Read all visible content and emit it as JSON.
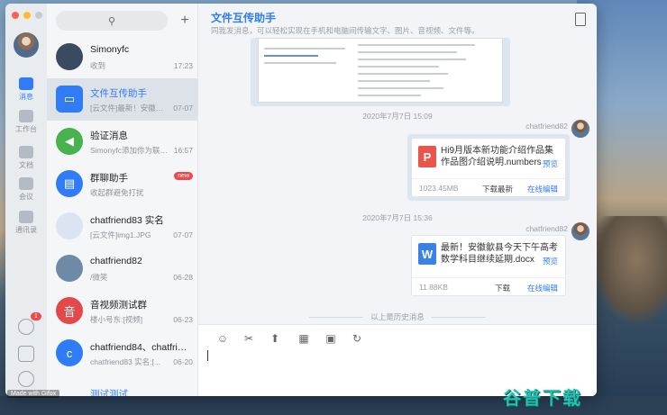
{
  "window": {
    "title": "文件互传助手",
    "subtitle": "同我发消息，可以轻松实现在手机和电脑间传输文字、图片、音视频、文件等。"
  },
  "rail": {
    "items": [
      {
        "label": "消息",
        "icon": "message-icon",
        "active": true
      },
      {
        "label": "工作台",
        "icon": "workbench-icon",
        "active": false
      },
      {
        "label": "文档",
        "icon": "document-icon",
        "active": false
      },
      {
        "label": "会议",
        "icon": "meeting-icon",
        "active": false
      },
      {
        "label": "通讯录",
        "icon": "contacts-icon",
        "active": false
      }
    ],
    "call_badge": "1"
  },
  "search": {
    "icon": "search-icon"
  },
  "conversations": [
    {
      "name": "Simonyfc",
      "preview": "收到",
      "time": "17:23",
      "avatar_color": "#3b4b5f"
    },
    {
      "name": "文件互传助手",
      "preview": "[云文件]最新！安徽歙县今天下午...",
      "time": "07-07",
      "avatar_color": "#2f7cf6",
      "active": true
    },
    {
      "name": "验证消息",
      "preview": "Simonyfc添加你为联系人",
      "time": "16:57",
      "avatar_color": "#47b34f"
    },
    {
      "name": "群聊助手",
      "preview": "收起群避免打扰",
      "time": "",
      "avatar_color": "#2f7cf6",
      "badge": "new"
    },
    {
      "name": "chatfriend83 实名",
      "preview": "[云文件]img1.JPG",
      "time": "07-07",
      "avatar_color": "#c7d5ec"
    },
    {
      "name": "chatfriend82",
      "preview": "/微笑",
      "time": "06-28",
      "avatar_color": "#6f8aa6"
    },
    {
      "name": "音视频测试群",
      "preview": "楼小号东:[视频]",
      "time": "06-23",
      "avatar_color": "#e24a4a",
      "avatar_text": "音"
    },
    {
      "name": "chatfriend84、chatfriend...",
      "preview": "chatfriend83 实名:[...",
      "time": "06-20",
      "avatar_color": "#2f7cf6",
      "avatar_text": "c"
    },
    {
      "name": "测试测试",
      "preview": "",
      "time": "",
      "avatar_color": "#2f7cf6"
    }
  ],
  "messages": [
    {
      "timestamp": "2020年7月7日 15:09",
      "sender": "chatfriend82",
      "file_name": "Hi9月版本新功能介绍作品集作品图介绍说明.numbers",
      "file_type_letter": "P",
      "file_color": "#e8554a",
      "size": "1023.45MB",
      "preview": "预览",
      "download": "下载最新",
      "edit": "在线编辑"
    },
    {
      "timestamp": "2020年7月7日 15:36",
      "sender": "chatfriend82",
      "file_name": "最新！安徽歙县今天下午高考数学科目继续延期.docx",
      "file_type_letter": "W",
      "file_color": "#3b82e6",
      "size": "11.88KB",
      "preview": "预览",
      "download": "下载",
      "edit": "在线编辑"
    }
  ],
  "history_label": "以上是历史消息",
  "toolbar_icons": [
    "emoji-icon",
    "scissors-icon",
    "upload-icon",
    "apps-icon",
    "contact-card-icon",
    "history-icon"
  ],
  "watermarks": {
    "left": "Made with Gifox",
    "right": "谷普下载"
  }
}
